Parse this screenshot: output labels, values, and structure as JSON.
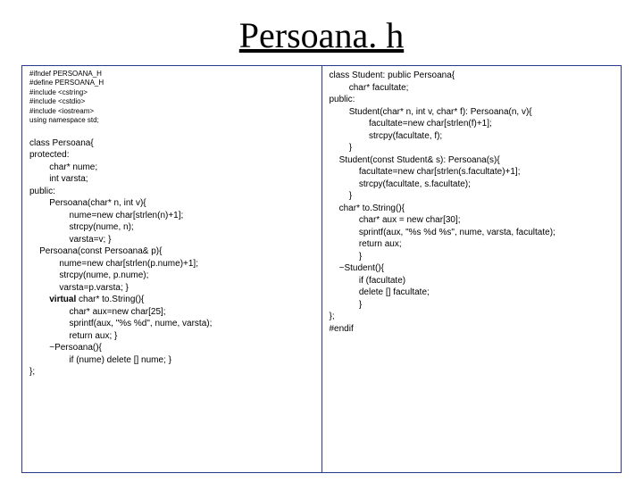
{
  "title": "Persoana. h",
  "left": {
    "preamble": "#ifndef PERSOANA_H\n#define PERSOANA_H\n#include <cstring>\n#include <cstdio>\n#include <iostream>\nusing namespace std;",
    "class_decl": "class Persoana{\nprotected:",
    "members": "        char* nume;\n        int varsta;\n",
    "public_kw": "public:",
    "ctor1": "        Persoana(char* n, int v){\n                nume=new char[strlen(n)+1];\n                strcpy(nume, n);\n                varsta=v; }\n",
    "ctor2": "    Persoana(const Persoana& p){\n            nume=new char[strlen(p.nume)+1];\n            strcpy(nume, p.nume);\n            varsta=p.varsta; }\n",
    "virtual_kw": "        virtual",
    "tostring": " char* to.String(){\n                char* aux=new char[25];\n                sprintf(aux, \"%s %d\", nume, varsta);\n                return aux; }\n",
    "dtor": "        ~Persoana(){\n                if (nume) delete [] nume; }\n};"
  },
  "right": {
    "class_decl": "class Student: public Persoana{",
    "member": "        char* facultate;",
    "public_kw": "public:",
    "ctor1": "        Student(char* n, int v, char* f): Persoana(n, v){\n                facultate=new char[strlen(f)+1];\n                strcpy(facultate, f);\n        }\n",
    "ctor2": "    Student(const Student& s): Persoana(s){\n            facultate=new char[strlen(s.facultate)+1];\n            strcpy(facultate, s.facultate);\n        }\n",
    "tostring": "    char* to.String(){\n            char* aux = new char[30];\n            sprintf(aux, \"%s %d %s\", nume, varsta, facultate);\n            return aux;\n            }\n",
    "dtor": "    ~Student(){\n            if (facultate)\n            delete [] facultate;\n            }\n};\n#endif"
  }
}
